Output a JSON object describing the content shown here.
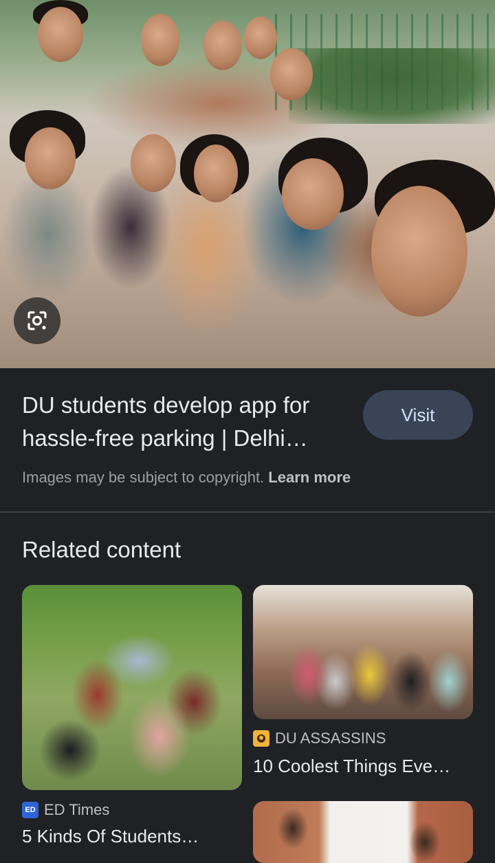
{
  "hero": {
    "image_alt": "Group of students taking a selfie",
    "lens_icon": "google-lens-icon"
  },
  "result": {
    "title": "DU students develop app for hassle-free parking | Delhi…",
    "visit_label": "Visit",
    "copyright_text": "Images may be subject to copyright. ",
    "learn_more_label": "Learn more"
  },
  "related": {
    "heading": "Related content",
    "cards": [
      {
        "source": "ED Times",
        "source_icon": "ed-times-logo-icon",
        "logo_text": "ED",
        "title": "5 Kinds Of Students…"
      },
      {
        "source": "DU ASSASSINS",
        "source_icon": "du-assassins-logo-icon",
        "logo_text": "",
        "title": "10 Coolest Things Eve…"
      },
      {
        "source": "",
        "title": ""
      }
    ]
  },
  "colors": {
    "background": "#202124",
    "visit_button": "#394457",
    "visit_text": "#d2e3fc",
    "divider": "#3c4043"
  }
}
